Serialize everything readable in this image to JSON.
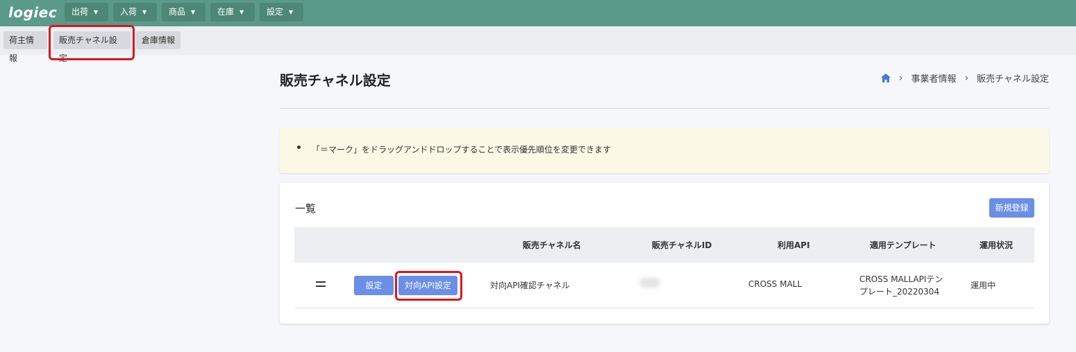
{
  "app": {
    "logo": "logiec"
  },
  "nav": {
    "menus": [
      "出荷",
      "入荷",
      "商品",
      "在庫",
      "設定"
    ]
  },
  "subnav": {
    "tabs": [
      "荷主情報",
      "販売チャネル設定",
      "倉庫情報"
    ]
  },
  "page": {
    "title": "販売チャネル設定",
    "breadcrumb": [
      "事業者情報",
      "販売チャネル設定"
    ]
  },
  "notice": {
    "text": "「＝マーク」をドラッグアンドドロップすることで表示優先順位を変更できます"
  },
  "list": {
    "title": "一覧",
    "new_button": "新規登録",
    "columns": [
      "販売チャネル名",
      "販売チャネルID",
      "利用API",
      "適用テンプレート",
      "運用状況"
    ],
    "rows": [
      {
        "settings_button": "設定",
        "api_settings_button": "対向API設定",
        "channel_name": "対向API確認チャネル",
        "channel_id": "",
        "api": "CROSS MALL",
        "template_line1": "CROSS MALLAPIテン",
        "template_line2": "プレート_20220304",
        "status": "運用中"
      }
    ]
  },
  "colors": {
    "topbar": "#5a9a8a",
    "accent": "#6b8fe6",
    "highlight": "#e0141c",
    "notice_bg": "#fbf9e6"
  }
}
